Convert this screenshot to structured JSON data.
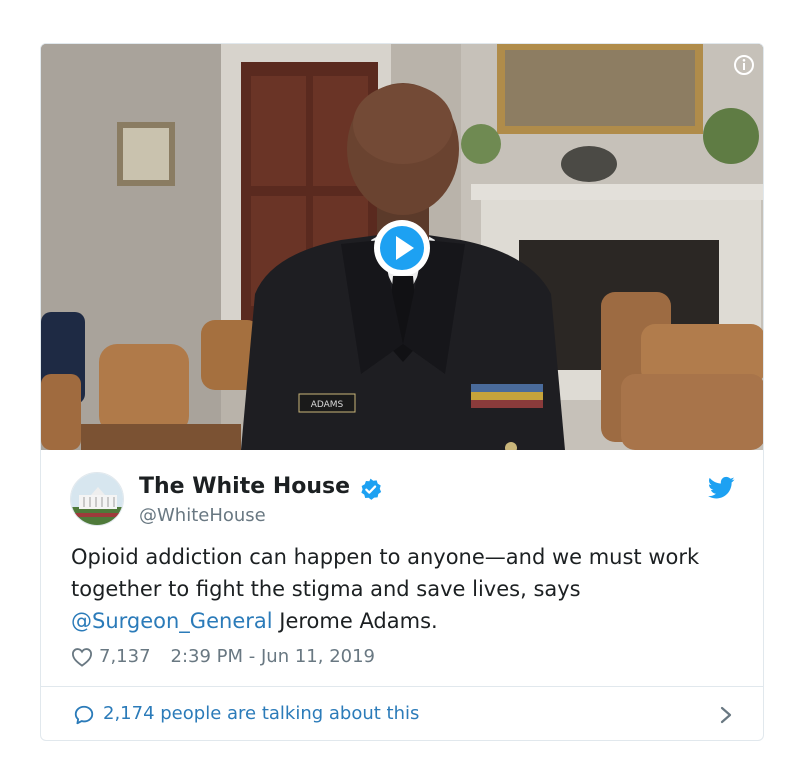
{
  "tweet": {
    "author": {
      "display_name": "The White House",
      "handle": "@WhiteHouse",
      "verified": true
    },
    "text_before": "Opioid addiction can happen to anyone—and we must work together to fight the stigma and save lives, says ",
    "mention": "@Surgeon_General",
    "text_after": " Jerome Adams.",
    "likes": "7,137",
    "timestamp": "2:39 PM - Jun 11, 2019",
    "conversation_label": "2,174 people are talking about this",
    "media": {
      "type": "video",
      "uniform_name_tag": "ADAMS"
    }
  },
  "colors": {
    "link": "#2b7bb9",
    "secondary_text": "#697882",
    "verified": "#1da1f2",
    "border": "#e1e8ed"
  },
  "icons": [
    "info-icon",
    "play-icon",
    "verified-icon",
    "twitter-icon",
    "heart-icon",
    "speech-bubble-icon",
    "chevron-right-icon"
  ]
}
